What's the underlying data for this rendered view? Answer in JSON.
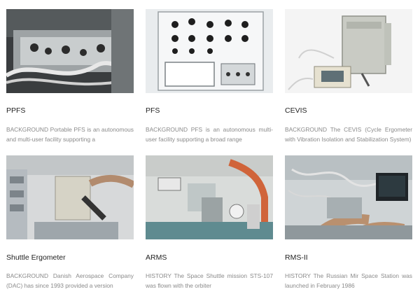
{
  "cards": [
    {
      "title": "PPFS",
      "description": "BACKGROUND Portable PFS is an autonomous and multi-user facility supporting a",
      "image_alt": "PPFS equipment photo"
    },
    {
      "title": "PFS",
      "description": "BACKGROUND PFS is an autonomous multi-user facility supporting a broad range",
      "image_alt": "PFS panel photo"
    },
    {
      "title": "CEVIS",
      "description": "BACKGROUND The CEVIS (Cycle Ergometer with Vibration Isolation and Stabilization System)",
      "image_alt": "CEVIS unit photo"
    },
    {
      "title": "Shuttle Ergometer",
      "description": "BACKGROUND Danish Aerospace Company (DAC) has since 1993 provided a version",
      "image_alt": "Shuttle Ergometer in orbit photo"
    },
    {
      "title": "ARMS",
      "description": "HISTORY The Space Shuttle mission STS-107 was flown with the orbiter",
      "image_alt": "ARMS hardware photo"
    },
    {
      "title": "RMS-II",
      "description": "HISTORY The Russian Mir Space Station was launched in February 1986",
      "image_alt": "RMS-II on Mir photo"
    }
  ]
}
